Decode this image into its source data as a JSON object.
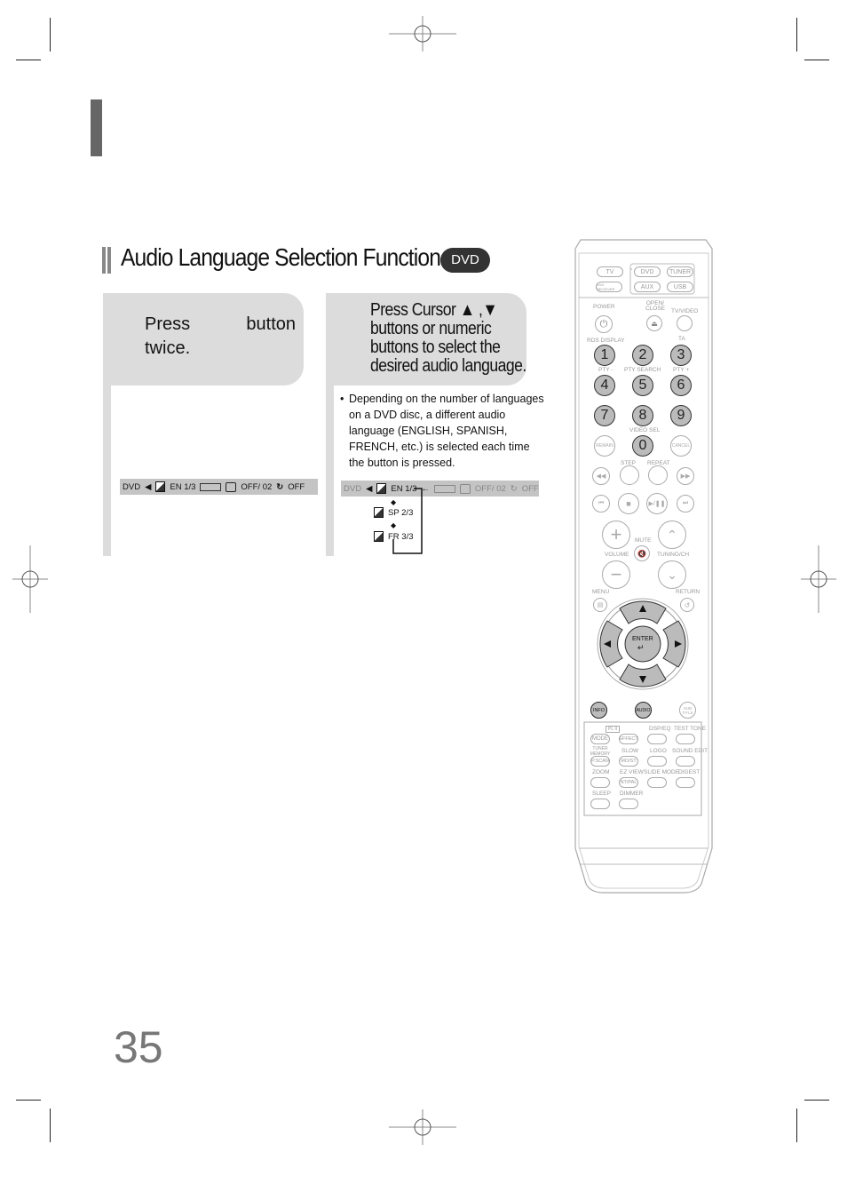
{
  "page": {
    "section_title": "Audio Language Selection Function",
    "badge": "DVD",
    "page_number": "35"
  },
  "step1": {
    "word1": "Press",
    "word2": "button",
    "line2": "twice.",
    "osd": {
      "source": "DVD",
      "audio": "EN 1/3",
      "subtitle": "OFF/ 02",
      "repeat": "OFF"
    }
  },
  "step2": {
    "lines": [
      "Press Cursor ▲ ,▼",
      "buttons or numeric",
      "buttons to select the",
      "desired audio language."
    ],
    "note_bullet": "•",
    "note": "Depending on the number of languages on a DVD disc, a different audio language (ENGLISH, SPANISH, FRENCH, etc.) is selected each time the button is pressed.",
    "osd": {
      "source": "DVD",
      "audio": "EN 1/3",
      "subtitle": "OFF/ 02",
      "repeat": "OFF"
    },
    "languages": [
      "SP 2/3",
      "FR 3/3"
    ]
  },
  "remote": {
    "source_buttons": [
      "TV",
      "DVD",
      "TUNER",
      "DVD RECEIVER",
      "AUX",
      "USB"
    ],
    "labels": {
      "power": "POWER",
      "open_close": "OPEN/\nCLOSE",
      "tv_video": "TV/VIDEO",
      "rds_display": "RDS DISPLAY",
      "ta": "TA",
      "pty_minus": "PTY -",
      "pty_search": "PTY SEARCH",
      "pty_plus": "PTY +",
      "video_sel": "VIDEO SEL",
      "step": "STEP",
      "repeat": "REPEAT",
      "mute": "MUTE",
      "volume": "VOLUME",
      "tuning_ch": "TUNING/CH",
      "menu": "MENU",
      "return": "RETURN",
      "enter": "ENTER"
    },
    "numbers": [
      "1",
      "2",
      "3",
      "4",
      "5",
      "6",
      "7",
      "8",
      "9",
      "0"
    ],
    "remain": "REMAIN",
    "cancel": "CANCEL",
    "info": "INFO",
    "audio": "AUDIO",
    "subtitle": "SUB TITLE",
    "bottom_panel": {
      "pl2": "PL II",
      "mode": "MODE",
      "effect": "EFFECT",
      "dsp_eq": "DSP/EQ",
      "test_tone": "TEST TONE",
      "tuner_memory": "TUNER MEMORY",
      "slow": "SLOW",
      "logo": "LOGO",
      "sound_edit": "SOUND EDIT",
      "p_scan": "P.SCAN",
      "mo_st": "MO/ST",
      "zoom": "ZOOM",
      "ez_view": "EZ VIEW",
      "slide_mode": "SLIDE MODE",
      "digest": "DIGEST",
      "nt_pal": "NT/PAL",
      "sleep": "SLEEP",
      "dimmer": "DIMMER"
    }
  }
}
